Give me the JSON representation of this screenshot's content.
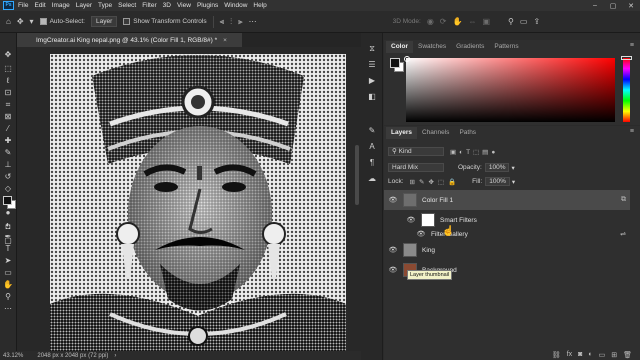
{
  "app": {
    "logo_text": "Ps",
    "menu": [
      "File",
      "Edit",
      "Image",
      "Layer",
      "Type",
      "Select",
      "Filter",
      "3D",
      "View",
      "Plugins",
      "Window",
      "Help"
    ],
    "window_controls": [
      "–",
      "▢",
      "✕"
    ]
  },
  "options_bar": {
    "auto_select_label": "Auto-Select:",
    "auto_select_checked": true,
    "auto_select_target": "Layer",
    "show_transform_label": "Show Transform Controls",
    "three_d_mode": "3D Mode:"
  },
  "document": {
    "tab_title": "ImgCreator.ai  King nepal.png @ 43.1% (Color Fill 1, RGB/8#) *",
    "close_glyph": "×",
    "zoom": "43.12%",
    "dimensions": "2048 px x 2048 px (72 ppi)"
  },
  "color_panel": {
    "tabs": [
      "Color",
      "Swatches",
      "Gradients",
      "Patterns"
    ],
    "active_tab": "Color",
    "hue_color": "#ff0000",
    "foreground": "#111111",
    "background": "#ffffff"
  },
  "layers_panel": {
    "tabs": [
      "Layers",
      "Channels",
      "Paths"
    ],
    "active_tab": "Layers",
    "filter_kind": "Kind",
    "blend_mode": "Hard Mix",
    "opacity_label": "Opacity:",
    "opacity_value": "100%",
    "lock_label": "Lock:",
    "fill_label": "Fill:",
    "fill_value": "100%",
    "layers": [
      {
        "name": "Color Fill 1",
        "visible": true,
        "selected": true
      },
      {
        "name": "Smart Filters",
        "visible": true,
        "sub": true
      },
      {
        "name": "Filter Gallery",
        "visible": true,
        "sub": true
      },
      {
        "name": "King",
        "visible": true
      },
      {
        "name": "Background",
        "visible": true
      }
    ],
    "tooltip": "Layer thumbnail"
  }
}
